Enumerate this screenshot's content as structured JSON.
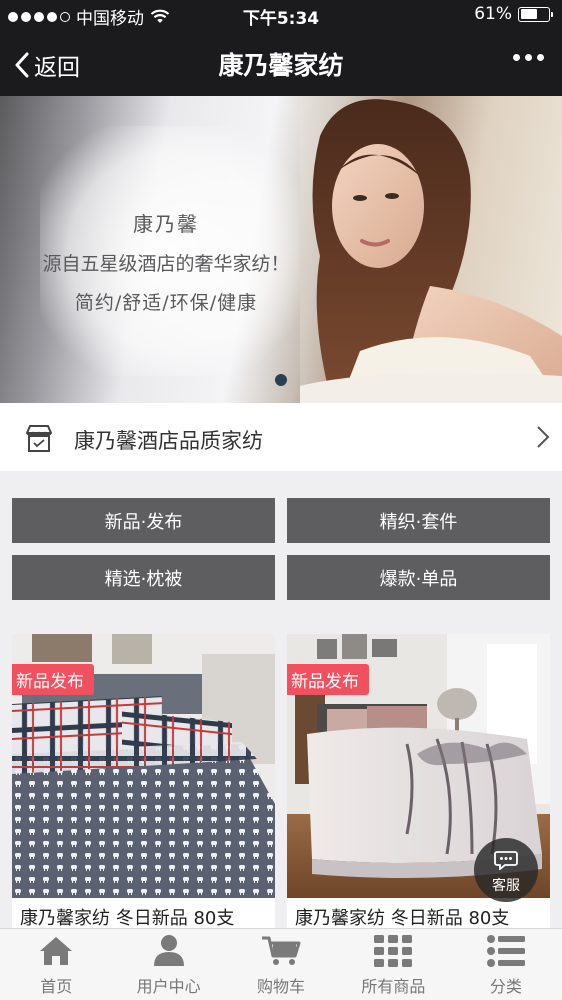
{
  "status_bar": {
    "carrier": "中国移动",
    "time": "下午5:34",
    "battery_percent": "61%",
    "battery_level": 0.61,
    "signal_icon": "signal-dots-icon",
    "wifi_icon": "wifi-icon"
  },
  "nav": {
    "back_label": "返回",
    "title": "康乃馨家纺",
    "back_icon": "chevron-left-icon",
    "more_icon": "more-dots-icon"
  },
  "banner": {
    "line1": "康乃馨",
    "line2": "源自五星级酒店的奢华家纺！",
    "line3": "简约/舒适/环保/健康",
    "slide_count": 1,
    "active_slide": 1
  },
  "store": {
    "name": "康乃馨酒店品质家纺",
    "icon": "store-icon",
    "arrow_icon": "chevron-right-icon"
  },
  "categories": [
    {
      "label": "新品·发布"
    },
    {
      "label": "精织·套件"
    },
    {
      "label": "精选·枕被"
    },
    {
      "label": "爆款·单品"
    }
  ],
  "products": [
    {
      "tag": "新品发布",
      "title": "康乃馨家纺 冬日新品 80支"
    },
    {
      "tag": "新品发布",
      "title": "康乃馨家纺 冬日新品 80支"
    }
  ],
  "customer_service": {
    "label": "客服",
    "icon": "chat-bubble-icon"
  },
  "tabs": [
    {
      "label": "首页",
      "icon": "home-icon"
    },
    {
      "label": "用户中心",
      "icon": "user-icon"
    },
    {
      "label": "购物车",
      "icon": "cart-icon"
    },
    {
      "label": "所有商品",
      "icon": "grid-icon"
    },
    {
      "label": "分类",
      "icon": "list-icon"
    }
  ],
  "colors": {
    "header_bg": "#1b1b1d",
    "category_bg": "#5e5e60",
    "tag_bg": "#f1515f",
    "tab_icon": "#7a7a7a"
  }
}
